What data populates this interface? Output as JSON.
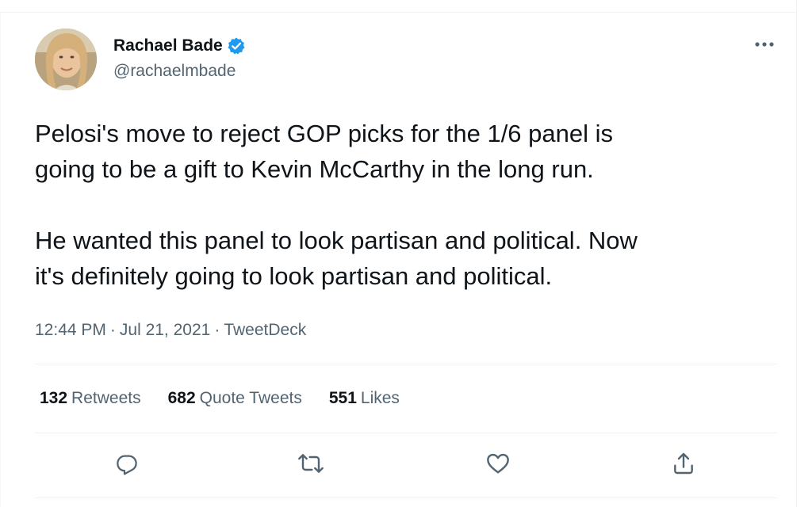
{
  "author": {
    "display_name": "Rachael Bade",
    "handle": "@rachaelmbade",
    "verified": true,
    "avatar_icon": "profile-photo"
  },
  "tweet": {
    "paragraphs": [
      "Pelosi's move to reject GOP picks for the 1/6 panel is\ngoing to be a gift to Kevin McCarthy in the long run.",
      "He wanted this panel to look partisan and political. Now\nit's definitely going to look partisan and political."
    ],
    "time": "12:44 PM",
    "date": "Jul 21, 2021",
    "separator": "·",
    "source": "TweetDeck"
  },
  "stats": {
    "retweets": {
      "count": "132",
      "label": "Retweets"
    },
    "quote_tweets": {
      "count": "682",
      "label": "Quote Tweets"
    },
    "likes": {
      "count": "551",
      "label": "Likes"
    }
  },
  "actions": [
    {
      "name": "reply",
      "icon": "reply-icon"
    },
    {
      "name": "retweet",
      "icon": "retweet-icon"
    },
    {
      "name": "like",
      "icon": "heart-icon"
    },
    {
      "name": "share",
      "icon": "share-icon"
    }
  ],
  "colors": {
    "text_primary": "#0f1419",
    "text_secondary": "#536471",
    "verified_blue": "#1d9bf0",
    "divider": "#eff3f4"
  }
}
